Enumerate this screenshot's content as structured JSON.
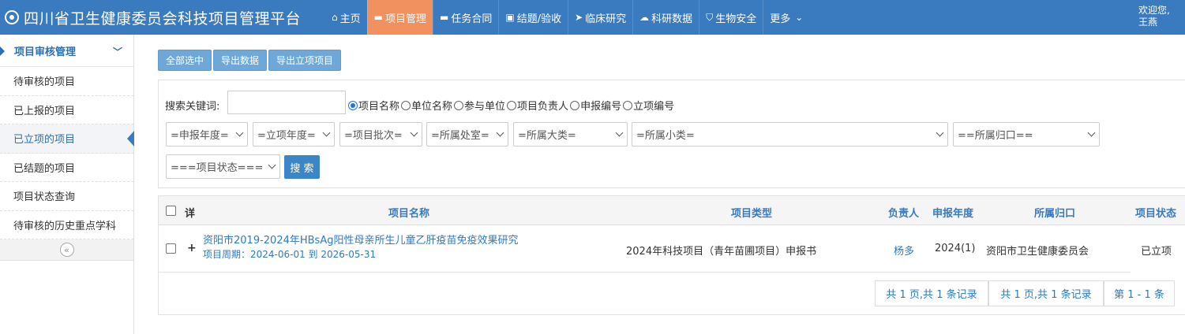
{
  "app": {
    "title": "四川省卫生健康委员会科技项目管理平台"
  },
  "nav": {
    "items": [
      {
        "label": "主页",
        "icon": "home-icon",
        "glyph": "⌂"
      },
      {
        "label": "项目管理",
        "icon": "folder-open-icon",
        "glyph": "▬"
      },
      {
        "label": "任务合同",
        "icon": "folder-icon",
        "glyph": "▬"
      },
      {
        "label": "结题/验收",
        "icon": "briefcase-icon",
        "glyph": "▣"
      },
      {
        "label": "临床研究",
        "icon": "send-icon",
        "glyph": "➤"
      },
      {
        "label": "科研数据",
        "icon": "cloud-icon",
        "glyph": "☁"
      },
      {
        "label": "生物安全",
        "icon": "shield-icon",
        "glyph": "⛉"
      },
      {
        "label": "更多",
        "icon": "chevron-down-icon",
        "glyph": "⌄"
      }
    ],
    "active_index": 1,
    "active_color": "#f0915f"
  },
  "user": {
    "greeting": "欢迎您,",
    "name": "王燕"
  },
  "sidebar": {
    "header": "项目审核管理",
    "items": [
      {
        "label": "待审核的项目"
      },
      {
        "label": "已上报的项目"
      },
      {
        "label": "已立项的项目"
      },
      {
        "label": "已结题的项目"
      },
      {
        "label": "项目状态查询"
      },
      {
        "label": "待审核的历史重点学科"
      }
    ],
    "active_index": 2
  },
  "toolbar": {
    "select_all": "全部选中",
    "export_data": "导出数据",
    "export_approved": "导出立项项目"
  },
  "search": {
    "label": "搜索关键词:",
    "keyword_value": "",
    "options": [
      "项目名称",
      "单位名称",
      "参与单位",
      "项目负责人",
      "申报编号",
      "立项编号"
    ],
    "selected_option": "项目名称",
    "filters": {
      "report_year": "=申报年度=",
      "approval_year": "=立项年度=",
      "batch": "=项目批次=",
      "office": "=所属处室=",
      "major_category": "=所属大类=",
      "minor_category": "=所属小类=",
      "affiliation": "==所属归口==",
      "status": "===项目状态==="
    },
    "button": "搜 索"
  },
  "table": {
    "columns": {
      "detail": "详",
      "name": "项目名称",
      "type": "项目类型",
      "leader": "负责人",
      "year": "申报年度",
      "affiliation": "所属归口",
      "status": "项目状态"
    },
    "rows": [
      {
        "expand": "+",
        "name": "资阳市2019-2024年HBsAg阳性母亲所生儿童乙肝疫苗免疫效果研究",
        "period": "项目周期：2024-06-01 到 2026-05-31",
        "type": "2024年科技项目（青年苗圃项目）申报书",
        "leader": "杨多",
        "year": "2024(1)",
        "affiliation": "资阳市卫生健康委员会",
        "status": "已立项"
      }
    ]
  },
  "pagination": {
    "summary_1": "共 1 页,共 1 条记录",
    "summary_2": "共 1 页,共 1 条记录",
    "range": "第 1 - 1 条"
  },
  "colors": {
    "primary": "#3a7abf",
    "accent": "#f0915f",
    "button": "#6ea8d9"
  }
}
